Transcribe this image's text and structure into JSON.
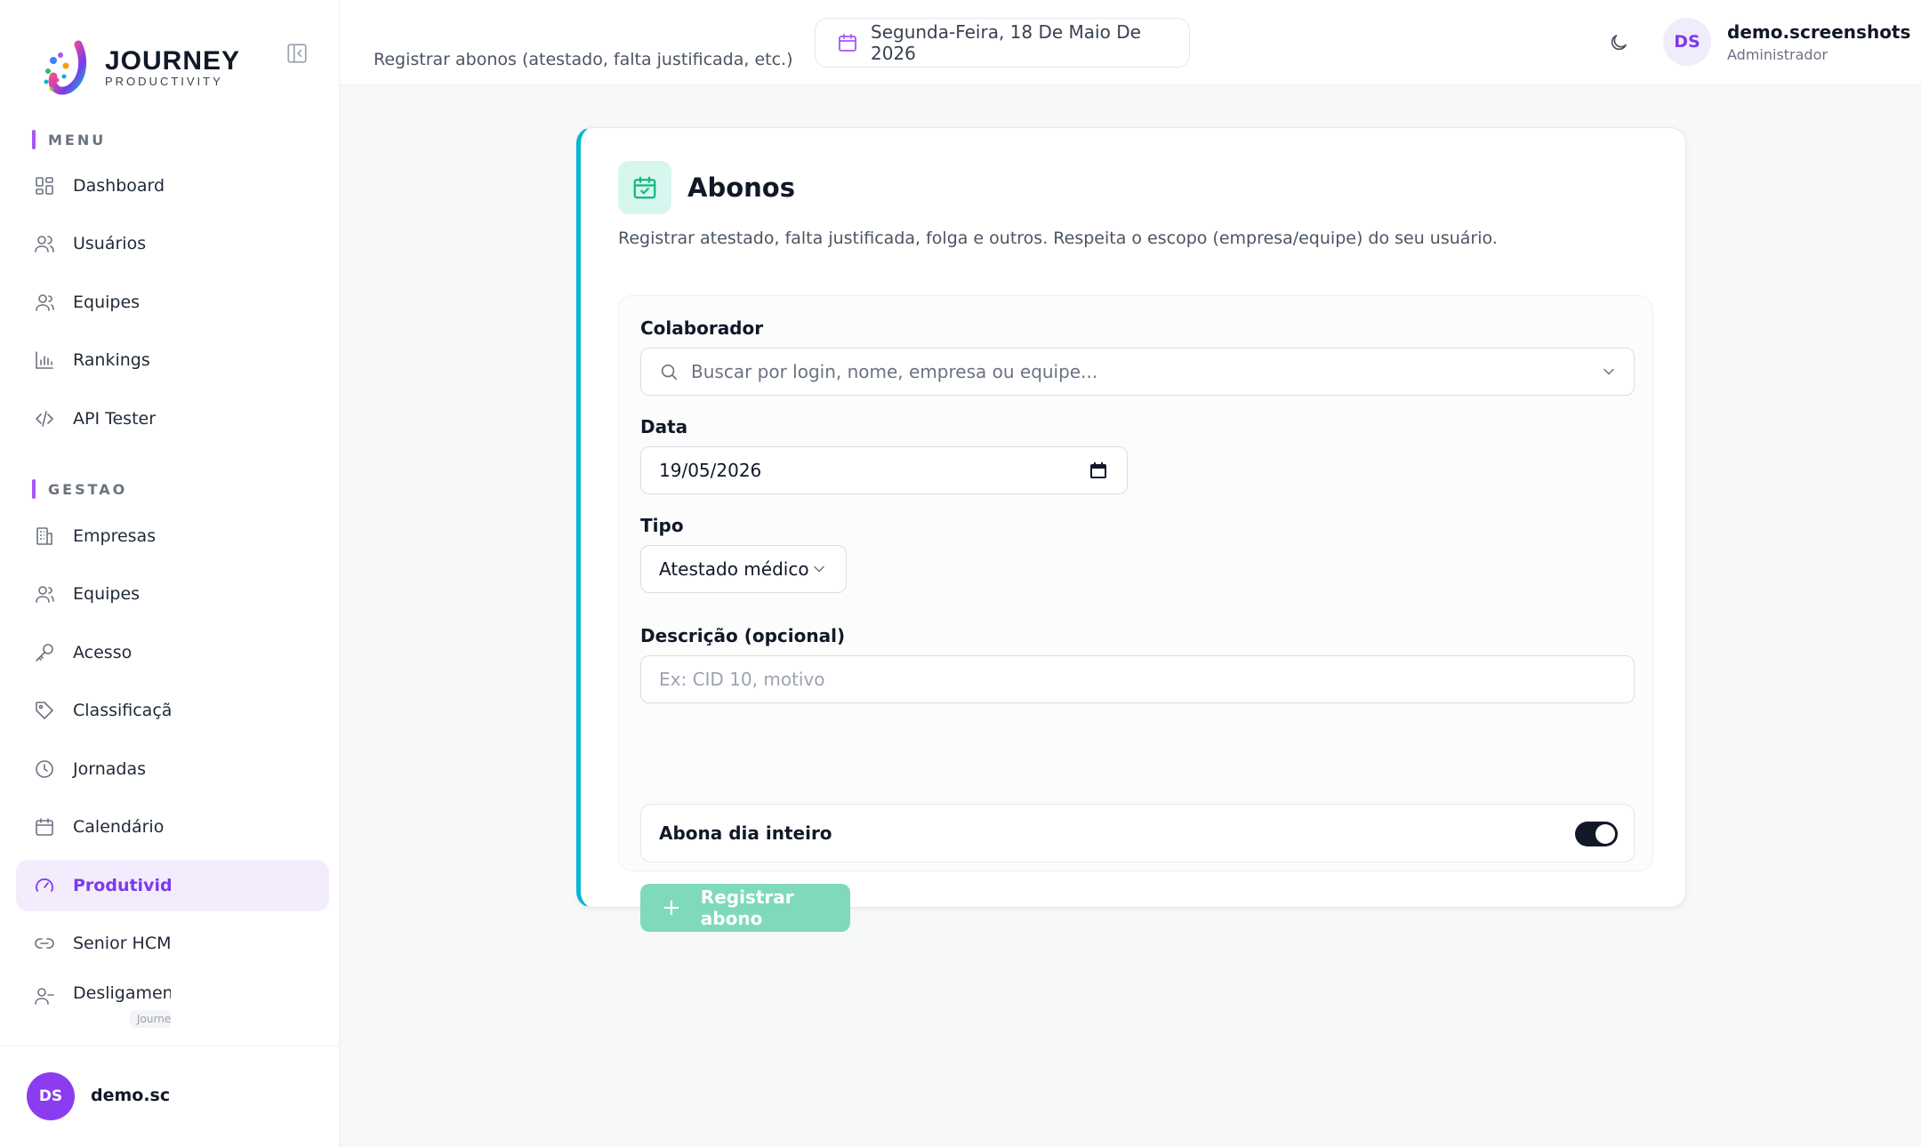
{
  "brand": {
    "name": "JOURNEY",
    "subtitle": "PRODUCTIVITY"
  },
  "sidebar": {
    "sections": [
      {
        "label": "MENU"
      },
      {
        "label": "GESTAO"
      }
    ],
    "menu_items": [
      {
        "label": "Dashboard",
        "icon": "grid-icon"
      },
      {
        "label": "Usuários",
        "icon": "users-icon"
      },
      {
        "label": "Equipes",
        "icon": "team-icon"
      },
      {
        "label": "Rankings",
        "icon": "bar-chart-icon"
      },
      {
        "label": "API Tester",
        "icon": "code-icon"
      }
    ],
    "gestao_items": [
      {
        "label": "Empresas",
        "icon": "building-icon"
      },
      {
        "label": "Equipes",
        "icon": "team-icon"
      },
      {
        "label": "Acesso",
        "icon": "key-icon"
      },
      {
        "label": "Classificação",
        "icon": "tag-icon"
      },
      {
        "label": "Jornadas",
        "icon": "clock-icon"
      },
      {
        "label": "Calendário",
        "icon": "calendar-icon"
      },
      {
        "label": "Produtividade",
        "icon": "gauge-icon",
        "active": true
      },
      {
        "label": "Senior HCM",
        "icon": "link-icon"
      },
      {
        "label": "Desligamentos",
        "icon": "user-minus-icon"
      }
    ],
    "version_tag": "Journey",
    "footer": {
      "avatar_initials": "DS",
      "username": "demo.screenshots"
    }
  },
  "header": {
    "subtitle": "Registrar abonos (atestado, falta justificada, etc.)",
    "date": "Segunda-Feira, 18 De Maio De 2026",
    "avatar_initials": "DS",
    "user_name": "demo.screenshots",
    "user_role": "Administrador"
  },
  "card": {
    "title": "Abonos",
    "description": "Registrar atestado, falta justificada, folga e outros. Respeita o escopo (empresa/equipe) do seu usuário.",
    "fields": {
      "colaborador_label": "Colaborador",
      "colaborador_placeholder": "Buscar por login, nome, empresa ou equipe...",
      "data_label": "Data",
      "data_value": "19/05/2026",
      "tipo_label": "Tipo",
      "tipo_value": "Atestado médico",
      "descricao_label": "Descrição (opcional)",
      "descricao_placeholder": "Ex: CID 10, motivo",
      "toggle_label": "Abona dia inteiro",
      "toggle_on": true
    },
    "submit_label": "Registrar abono"
  },
  "colors": {
    "accent_purple": "#7c3aed",
    "card_border_accent": "#06b6d4",
    "submit_button": "#7fd9bd",
    "icon_teal": "#10b981"
  }
}
